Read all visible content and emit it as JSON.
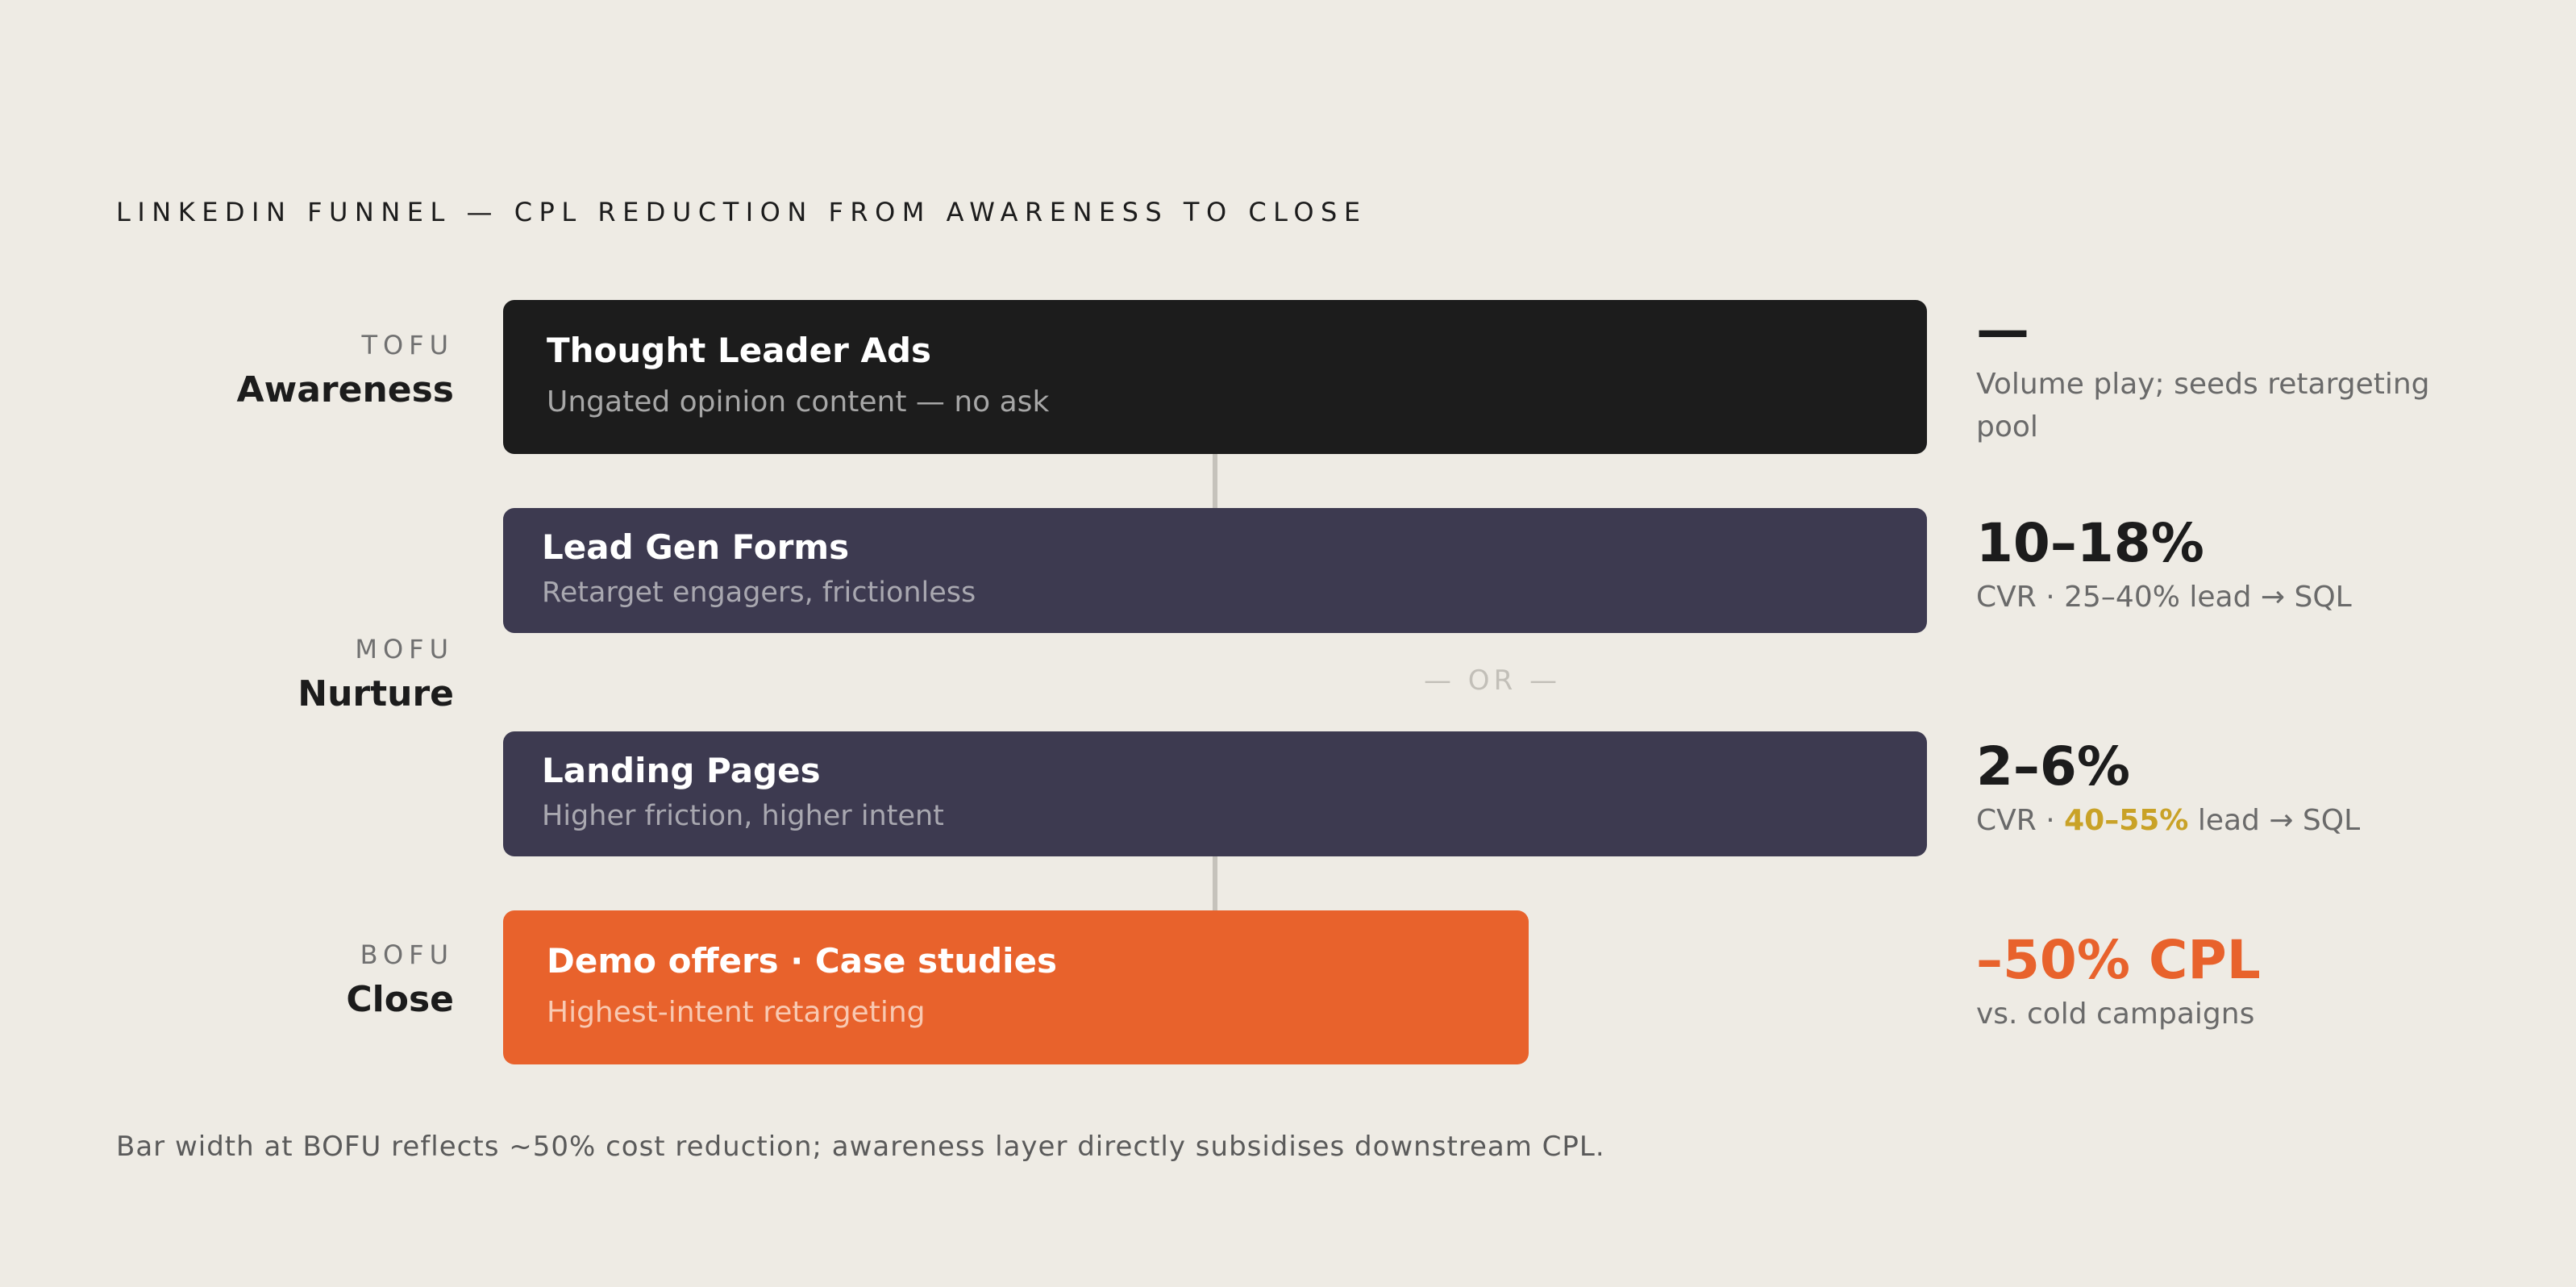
{
  "title": "LINKEDIN FUNNEL — CPL REDUCTION FROM AWARENESS TO CLOSE",
  "stages": {
    "tofu": {
      "tag": "TOFU",
      "name": "Awareness"
    },
    "mofu": {
      "tag": "MOFU",
      "name": "Nurture"
    },
    "bofu": {
      "tag": "BOFU",
      "name": "Close"
    }
  },
  "bars": {
    "tofu": {
      "title": "Thought Leader Ads",
      "subtitle": "Ungated opinion content — no ask"
    },
    "lead_gen_forms": {
      "title": "Lead Gen Forms",
      "subtitle": "Retarget engagers, frictionless"
    },
    "landing_pages": {
      "title": "Landing Pages",
      "subtitle": "Higher friction, higher intent"
    },
    "bofu": {
      "title": "Demo offers · Case studies",
      "subtitle": "Highest-intent retargeting"
    }
  },
  "or_label": "— OR —",
  "metrics": {
    "tofu": {
      "value": "—",
      "desc_line1": "Volume play; seeds retargeting",
      "desc_line2": "pool"
    },
    "lead_gen_forms": {
      "value": "10–18%",
      "desc": "CVR · 25–40% lead → SQL"
    },
    "landing_pages": {
      "value": "2–6%",
      "desc_prefix": "CVR · ",
      "desc_highlight": "40–55%",
      "desc_suffix": " lead → SQL"
    },
    "bofu": {
      "value": "–50% CPL",
      "desc": "vs. cold campaigns"
    }
  },
  "colors": {
    "background": "#eeebe4",
    "tofu_bar": "#1c1c1c",
    "mofu_bar": "#3d3a50",
    "bofu_bar": "#e8622c",
    "highlight": "#c9a227"
  },
  "footnote": "Bar width at BOFU reflects ~50% cost reduction; awareness layer directly subsidises downstream CPL."
}
